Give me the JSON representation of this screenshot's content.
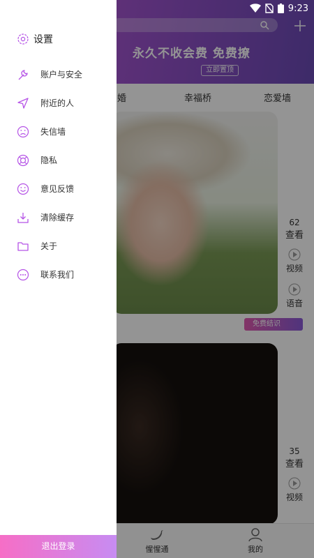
{
  "status_bar": {
    "time": "9:23"
  },
  "banner": {
    "text": "永久不收会费 免费撩",
    "pin_button": "立即置顶"
  },
  "tabs": [
    {
      "label": "婚"
    },
    {
      "label": "幸福桥"
    },
    {
      "label": "恋爱墙"
    }
  ],
  "cards": [
    {
      "views": "62",
      "views_label": "查看",
      "video_label": "视频",
      "voice_label": "语音"
    },
    {
      "views": "35",
      "views_label": "查看",
      "video_label": "视频"
    }
  ],
  "free_tag": "免费结识",
  "bottom_nav": [
    {
      "label": "惺惺通"
    },
    {
      "label": "我的"
    }
  ],
  "drawer": {
    "title": "设置",
    "items": [
      {
        "label": "账户与安全",
        "icon": "wrench-icon"
      },
      {
        "label": "附近的人",
        "icon": "location-arrow-icon"
      },
      {
        "label": "失信墙",
        "icon": "sad-face-icon"
      },
      {
        "label": "隐私",
        "icon": "lifebuoy-icon"
      },
      {
        "label": "意见反馈",
        "icon": "smile-face-icon"
      },
      {
        "label": "清除缓存",
        "icon": "download-tray-icon"
      },
      {
        "label": "关于",
        "icon": "folder-icon"
      },
      {
        "label": "联系我们",
        "icon": "chat-bubble-icon"
      }
    ],
    "logout": "退出登录"
  },
  "colors": {
    "accent": "#b553e6",
    "logout_start": "#f66ec6",
    "logout_end": "#c78cf2"
  }
}
